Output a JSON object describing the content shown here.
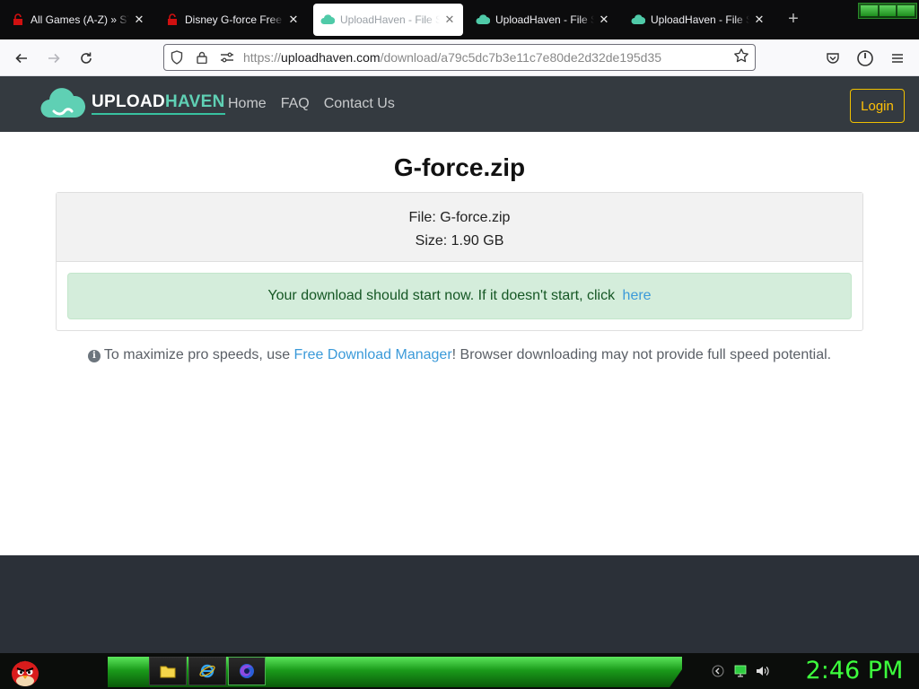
{
  "browser": {
    "tabs": [
      {
        "title": "All Games (A-Z) » STEAMUNLOCKED",
        "icon": "steamunlocked-icon",
        "active": false
      },
      {
        "title": "Disney G-force Free Download",
        "icon": "steamunlocked-icon",
        "active": false
      },
      {
        "title": "UploadHaven - File Sharing",
        "icon": "uploadhaven-icon",
        "active": true
      },
      {
        "title": "UploadHaven - File Sharing",
        "icon": "uploadhaven-icon",
        "active": false
      },
      {
        "title": "UploadHaven - File Sharing",
        "icon": "uploadhaven-icon",
        "active": false
      }
    ],
    "url": {
      "scheme": "https://",
      "host": "uploadhaven.com",
      "path": "/download/a79c5dc7b3e11c7e80de2d32de195d35"
    }
  },
  "site": {
    "brand_upload": "UPLOAD",
    "brand_haven": "HAVEN",
    "nav": [
      "Home",
      "FAQ",
      "Contact Us"
    ],
    "login_label": "Login"
  },
  "download": {
    "title": "G-force.zip",
    "file_line": "File: G-force.zip",
    "size_line": "Size: 1.90 GB",
    "alert_text": "Your download should start now. If it doesn't start, click ",
    "alert_link": "here",
    "note_prefix": "To maximize pro speeds, use ",
    "note_link": "Free Download Manager",
    "note_suffix": "! Browser downloading may not provide full speed potential."
  },
  "taskbar": {
    "clock": "2:46 PM",
    "pinned": [
      "file-explorer-icon",
      "internet-explorer-icon",
      "firefox-icon"
    ]
  },
  "colors": {
    "header_bg": "#343a40",
    "brand_accent": "#5fd0b4",
    "login_accent": "#ffc107",
    "alert_bg": "#d4eddb",
    "link": "#3b9ad9",
    "clock_green": "#3dff3d"
  }
}
